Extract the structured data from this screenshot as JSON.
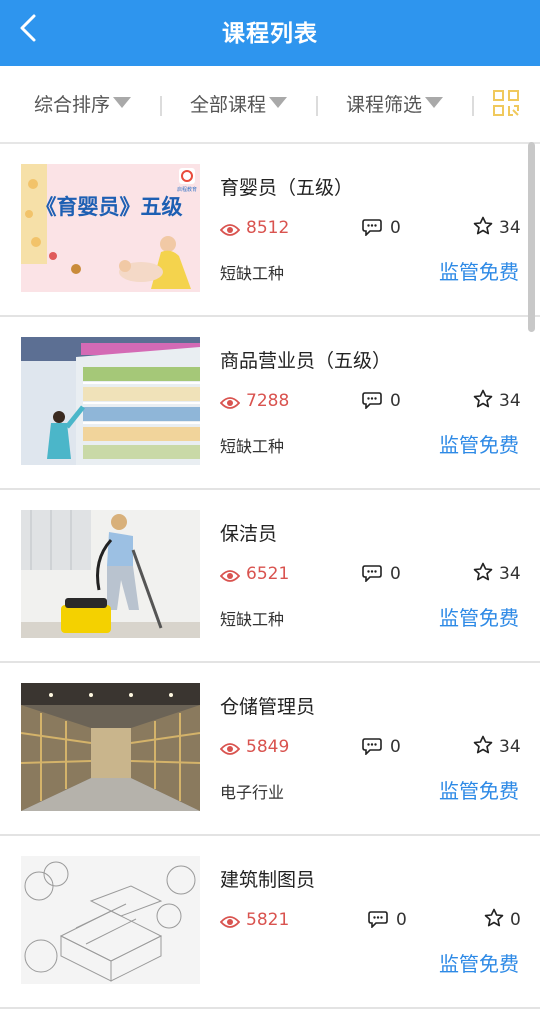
{
  "header": {
    "title": "课程列表",
    "back_icon": "chevron-left-icon"
  },
  "filters": {
    "sort_label": "综合排序",
    "courses_label": "全部课程",
    "screen_label": "课程筛选",
    "qr_icon": "qr-code-icon"
  },
  "colors": {
    "accent": "#2e95ee",
    "views": "#d9534f",
    "price": "#2e8ae6"
  },
  "courses": [
    {
      "name": "育婴员（五级）",
      "views": "8512",
      "comments": "0",
      "favorites": "34",
      "category": "短缺工种",
      "price": "监管免费",
      "cover_text": "《育婴员》五级",
      "cover_logo_text": "启程教育"
    },
    {
      "name": "商品营业员（五级）",
      "views": "7288",
      "comments": "0",
      "favorites": "34",
      "category": "短缺工种",
      "price": "监管免费"
    },
    {
      "name": "保洁员",
      "views": "6521",
      "comments": "0",
      "favorites": "34",
      "category": "短缺工种",
      "price": "监管免费"
    },
    {
      "name": "仓储管理员",
      "views": "5849",
      "comments": "0",
      "favorites": "34",
      "category": "电子行业",
      "price": "监管免费"
    },
    {
      "name": "建筑制图员",
      "views": "5821",
      "comments": "0",
      "favorites": "0",
      "category": "",
      "price": "监管免费"
    }
  ]
}
